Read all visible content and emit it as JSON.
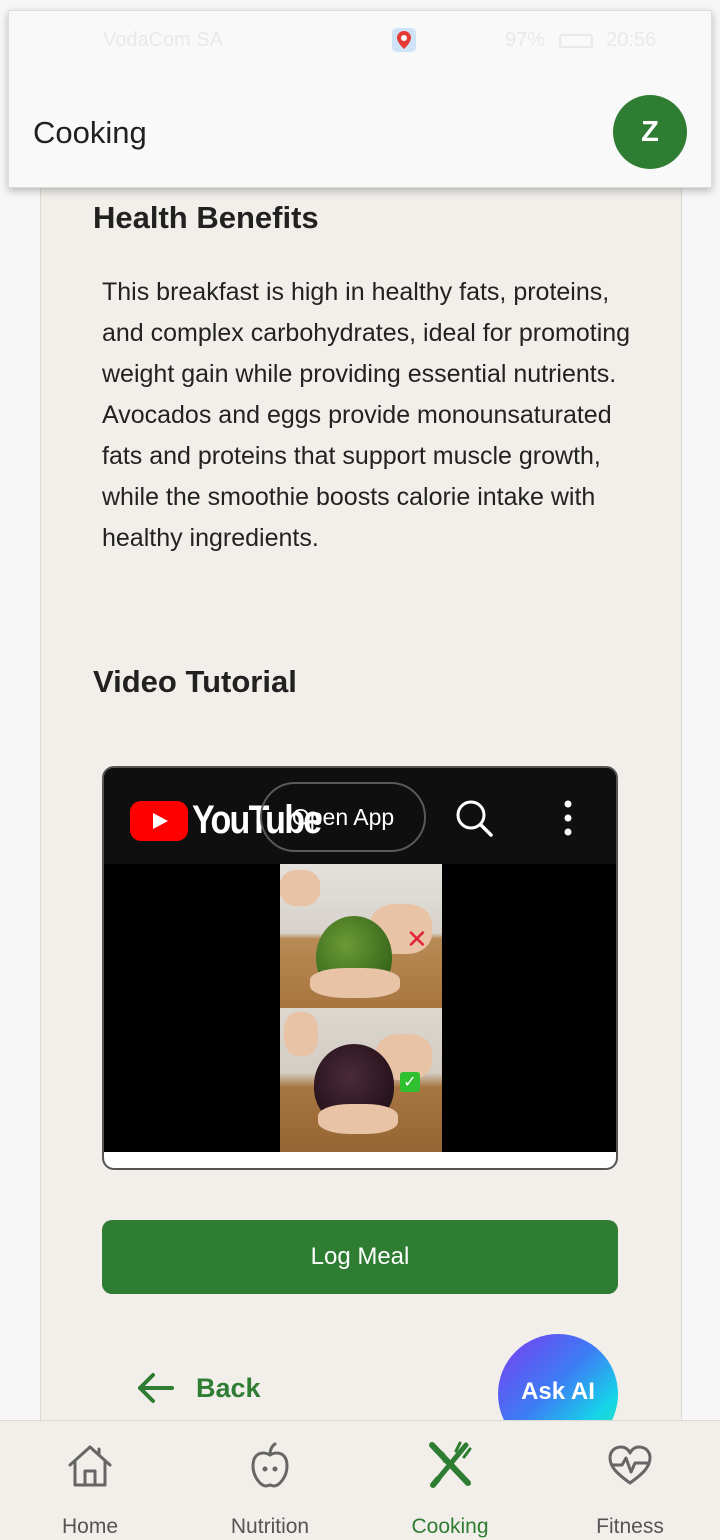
{
  "status_bar": {
    "left_text": "VodaCom SA",
    "battery_text": "97%",
    "time": "20:56"
  },
  "header": {
    "title": "Cooking",
    "avatar_initial": "Z"
  },
  "health_benefits": {
    "title": "Health Benefits",
    "text": "This breakfast is high in healthy fats, proteins, and complex carbohydrates, ideal for promoting weight gain while providing essential nutrients. Avocados and eggs provide monounsaturated fats and proteins that support muscle growth, while the smoothie boosts calorie intake with healthy ingredients."
  },
  "video_tutorial": {
    "title": "Video Tutorial",
    "player": {
      "logo_text": "YouTube",
      "open_app_label": "Open App",
      "icons": [
        "youtube-logo-icon",
        "search-icon",
        "more-vert-icon"
      ]
    }
  },
  "actions": {
    "log_meal_label": "Log Meal",
    "back_label": "Back",
    "ask_ai_label": "Ask AI"
  },
  "bottom_nav": {
    "active": "Cooking",
    "items": [
      {
        "label": "Home",
        "icon": "home-icon"
      },
      {
        "label": "Nutrition",
        "icon": "apple-icon"
      },
      {
        "label": "Cooking",
        "icon": "fork-knife-icon"
      },
      {
        "label": "Fitness",
        "icon": "heartbeat-icon"
      }
    ]
  },
  "colors": {
    "primary_green": "#2e7d32",
    "card_background": "#f2efeb",
    "ask_ai_gradient": [
      "#7a3cf0",
      "#3d7cf5",
      "#16d4e8",
      "#2ee8a0"
    ]
  }
}
